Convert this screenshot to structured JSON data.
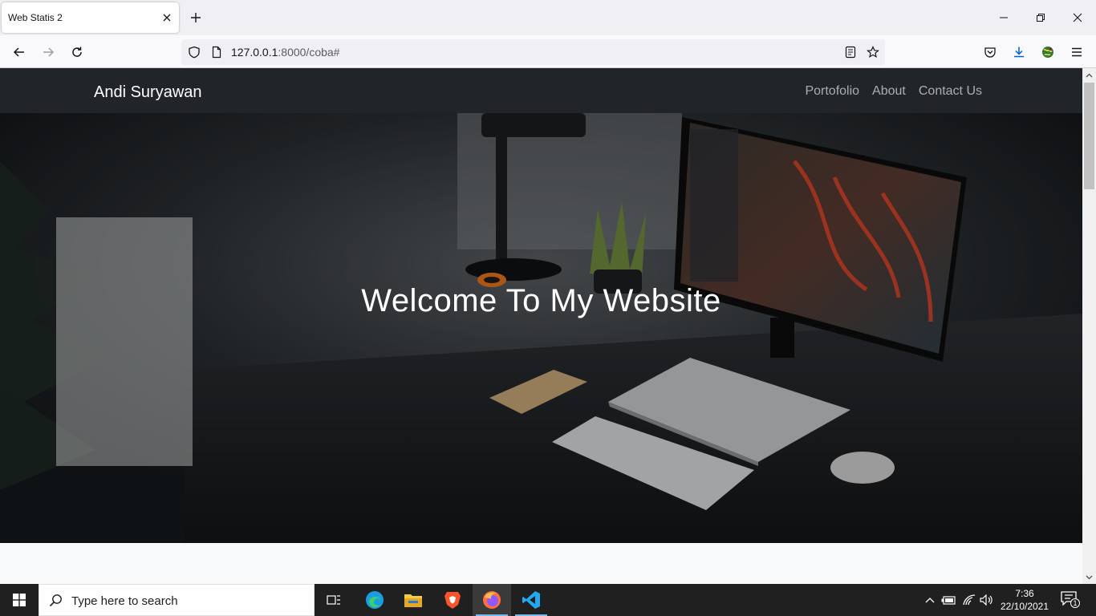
{
  "browser": {
    "tab": {
      "title": "Web Statis 2"
    },
    "url": {
      "host": "127.0.0.1",
      "rest": ":8000/coba#"
    }
  },
  "site": {
    "brand": "Andi Suryawan",
    "nav_links": [
      "Portofolio",
      "About",
      "Contact Us"
    ],
    "hero_title": "Welcome To My Website"
  },
  "taskbar": {
    "search_placeholder": "Type here to search",
    "apps": [
      "task-view",
      "edge",
      "file-explorer",
      "brave",
      "firefox",
      "vscode"
    ],
    "clock": {
      "time": "7:36",
      "date": "22/10/2021"
    },
    "notification_count": "1"
  },
  "colors": {
    "site_nav_bg": "#212529",
    "nav_link": "#bdbec0",
    "taskbar_bg": "#202020",
    "accent": "#0060df"
  }
}
